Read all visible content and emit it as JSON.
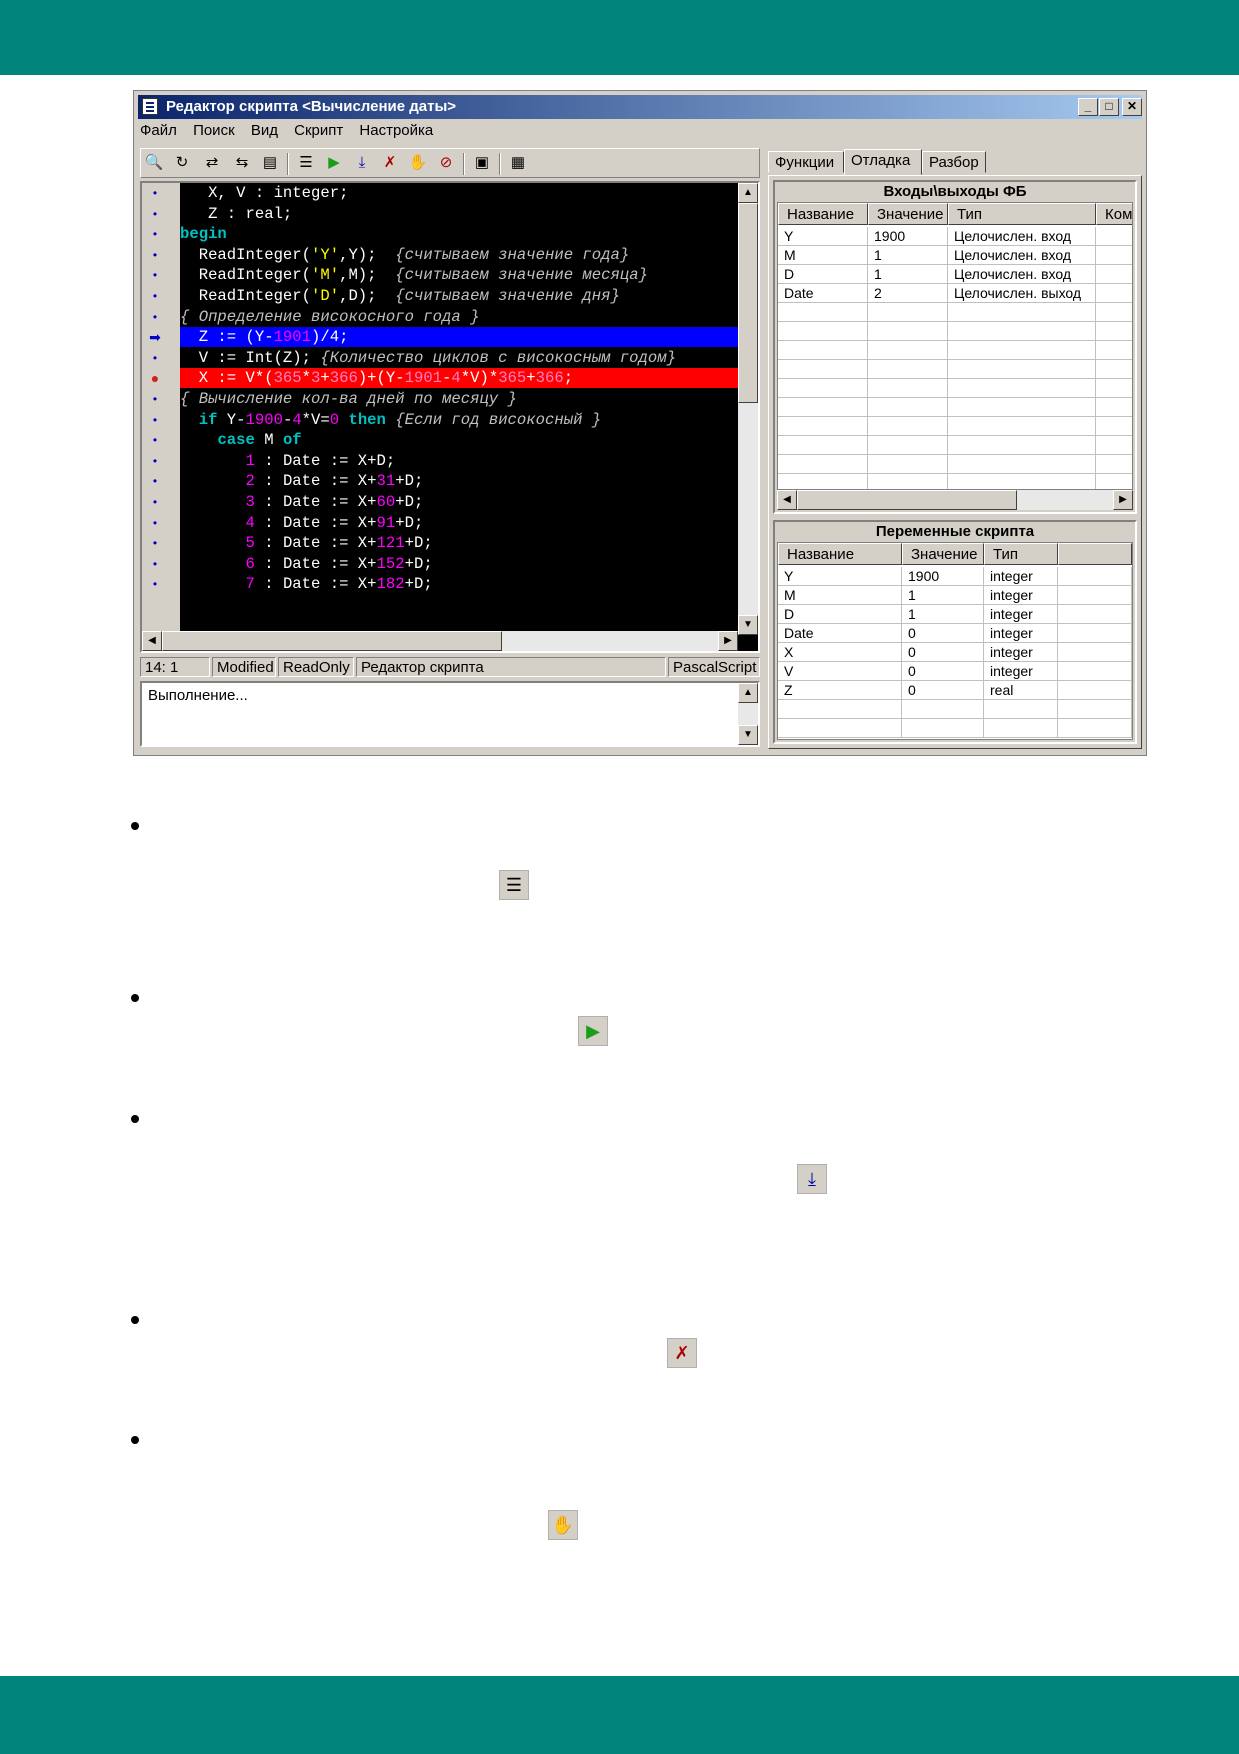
{
  "window": {
    "title": "Редактор скрипта <Вычисление даты>"
  },
  "menu": [
    "Файл",
    "Поиск",
    "Вид",
    "Скрипт",
    "Настройка"
  ],
  "code_lines": [
    [
      {
        "t": "   X, V : integer;",
        "c": ""
      }
    ],
    [
      {
        "t": "   Z : real;",
        "c": ""
      }
    ],
    [
      {
        "t": "begin",
        "c": "kw"
      }
    ],
    [
      {
        "t": "  ReadInteger(",
        "c": ""
      },
      {
        "t": "'Y'",
        "c": "str"
      },
      {
        "t": ",Y);  ",
        "c": ""
      },
      {
        "t": "{считываем значение года}",
        "c": "cm"
      }
    ],
    [
      {
        "t": "  ReadInteger(",
        "c": ""
      },
      {
        "t": "'M'",
        "c": "str"
      },
      {
        "t": ",M);  ",
        "c": ""
      },
      {
        "t": "{считываем значение месяца}",
        "c": "cm"
      }
    ],
    [
      {
        "t": "  ReadInteger(",
        "c": ""
      },
      {
        "t": "'D'",
        "c": "str"
      },
      {
        "t": ",D);  ",
        "c": ""
      },
      {
        "t": "{считываем значение дня}",
        "c": "cm"
      }
    ],
    [
      {
        "t": "{ Определение високосного года }",
        "c": "cm"
      }
    ],
    [
      {
        "t": "  Z := (Y-",
        "c": ""
      },
      {
        "t": "1901",
        "c": "num"
      },
      {
        "t": ")/4;",
        "c": ""
      }
    ],
    [
      {
        "t": "  V := Int(Z); ",
        "c": ""
      },
      {
        "t": "{Количество циклов с високосным годом}",
        "c": "cm"
      }
    ],
    [
      {
        "t": "  X := V*(",
        "c": ""
      },
      {
        "t": "365",
        "c": "num"
      },
      {
        "t": "*",
        "c": ""
      },
      {
        "t": "3",
        "c": "num"
      },
      {
        "t": "+",
        "c": ""
      },
      {
        "t": "366",
        "c": "num"
      },
      {
        "t": ")+(Y-",
        "c": ""
      },
      {
        "t": "1901",
        "c": "num"
      },
      {
        "t": "-",
        "c": ""
      },
      {
        "t": "4",
        "c": "num"
      },
      {
        "t": "*V)*",
        "c": ""
      },
      {
        "t": "365",
        "c": "num"
      },
      {
        "t": "+",
        "c": ""
      },
      {
        "t": "366",
        "c": "num"
      },
      {
        "t": ";",
        "c": ""
      }
    ],
    [
      {
        "t": "{ Вычисление кол-ва дней по месяцу }",
        "c": "cm"
      }
    ],
    [
      {
        "t": "  ",
        "c": ""
      },
      {
        "t": "if",
        "c": "kw"
      },
      {
        "t": " Y-",
        "c": ""
      },
      {
        "t": "1900",
        "c": "num"
      },
      {
        "t": "-",
        "c": ""
      },
      {
        "t": "4",
        "c": "num"
      },
      {
        "t": "*V=",
        "c": ""
      },
      {
        "t": "0",
        "c": "num"
      },
      {
        "t": " ",
        "c": ""
      },
      {
        "t": "then",
        "c": "kw"
      },
      {
        "t": " ",
        "c": ""
      },
      {
        "t": "{Если год високосный }",
        "c": "cm"
      }
    ],
    [
      {
        "t": "    ",
        "c": ""
      },
      {
        "t": "case",
        "c": "kw"
      },
      {
        "t": " M ",
        "c": ""
      },
      {
        "t": "of",
        "c": "kw"
      }
    ],
    [
      {
        "t": "       ",
        "c": ""
      },
      {
        "t": "1",
        "c": "num"
      },
      {
        "t": " : Date := X+D;",
        "c": ""
      }
    ],
    [
      {
        "t": "       ",
        "c": ""
      },
      {
        "t": "2",
        "c": "num"
      },
      {
        "t": " : Date := X+",
        "c": ""
      },
      {
        "t": "31",
        "c": "num"
      },
      {
        "t": "+D;",
        "c": ""
      }
    ],
    [
      {
        "t": "       ",
        "c": ""
      },
      {
        "t": "3",
        "c": "num"
      },
      {
        "t": " : Date := X+",
        "c": ""
      },
      {
        "t": "60",
        "c": "num"
      },
      {
        "t": "+D;",
        "c": ""
      }
    ],
    [
      {
        "t": "       ",
        "c": ""
      },
      {
        "t": "4",
        "c": "num"
      },
      {
        "t": " : Date := X+",
        "c": ""
      },
      {
        "t": "91",
        "c": "num"
      },
      {
        "t": "+D;",
        "c": ""
      }
    ],
    [
      {
        "t": "       ",
        "c": ""
      },
      {
        "t": "5",
        "c": "num"
      },
      {
        "t": " : Date := X+",
        "c": ""
      },
      {
        "t": "121",
        "c": "num"
      },
      {
        "t": "+D;",
        "c": ""
      }
    ],
    [
      {
        "t": "       ",
        "c": ""
      },
      {
        "t": "6",
        "c": "num"
      },
      {
        "t": " : Date := X+",
        "c": ""
      },
      {
        "t": "152",
        "c": "num"
      },
      {
        "t": "+D;",
        "c": ""
      }
    ],
    [
      {
        "t": "       ",
        "c": ""
      },
      {
        "t": "7",
        "c": "num"
      },
      {
        "t": " : Date := X+",
        "c": ""
      },
      {
        "t": "182",
        "c": "num"
      },
      {
        "t": "+D;",
        "c": ""
      }
    ]
  ],
  "status": {
    "position": "14:  1",
    "modified": "Modified",
    "readonly": "ReadOnly",
    "editor": "Редактор скрипта",
    "language": "PascalScript"
  },
  "output_text": "Выполнение...",
  "tabs": [
    "Функции",
    "Отладка",
    "Разбор"
  ],
  "io_group": {
    "title": "Входы\\выходы ФБ",
    "headers": [
      "Название",
      "Значение",
      "Тип",
      "Комм"
    ],
    "rows": [
      [
        "Y",
        "1900",
        "Целочислен. вход",
        ""
      ],
      [
        "M",
        "1",
        "Целочислен. вход",
        ""
      ],
      [
        "D",
        "1",
        "Целочислен. вход",
        ""
      ],
      [
        "Date",
        "2",
        "Целочислен. выход",
        ""
      ]
    ]
  },
  "vars_group": {
    "title": "Переменные скрипта",
    "headers": [
      "Название",
      "Значение",
      "Тип",
      ""
    ],
    "rows": [
      [
        "Y",
        "1900",
        "integer",
        ""
      ],
      [
        "M",
        "1",
        "integer",
        ""
      ],
      [
        "D",
        "1",
        "integer",
        ""
      ],
      [
        "Date",
        "0",
        "integer",
        ""
      ],
      [
        "X",
        "0",
        "integer",
        ""
      ],
      [
        "V",
        "0",
        "integer",
        ""
      ],
      [
        "Z",
        "0",
        "real",
        ""
      ]
    ]
  }
}
